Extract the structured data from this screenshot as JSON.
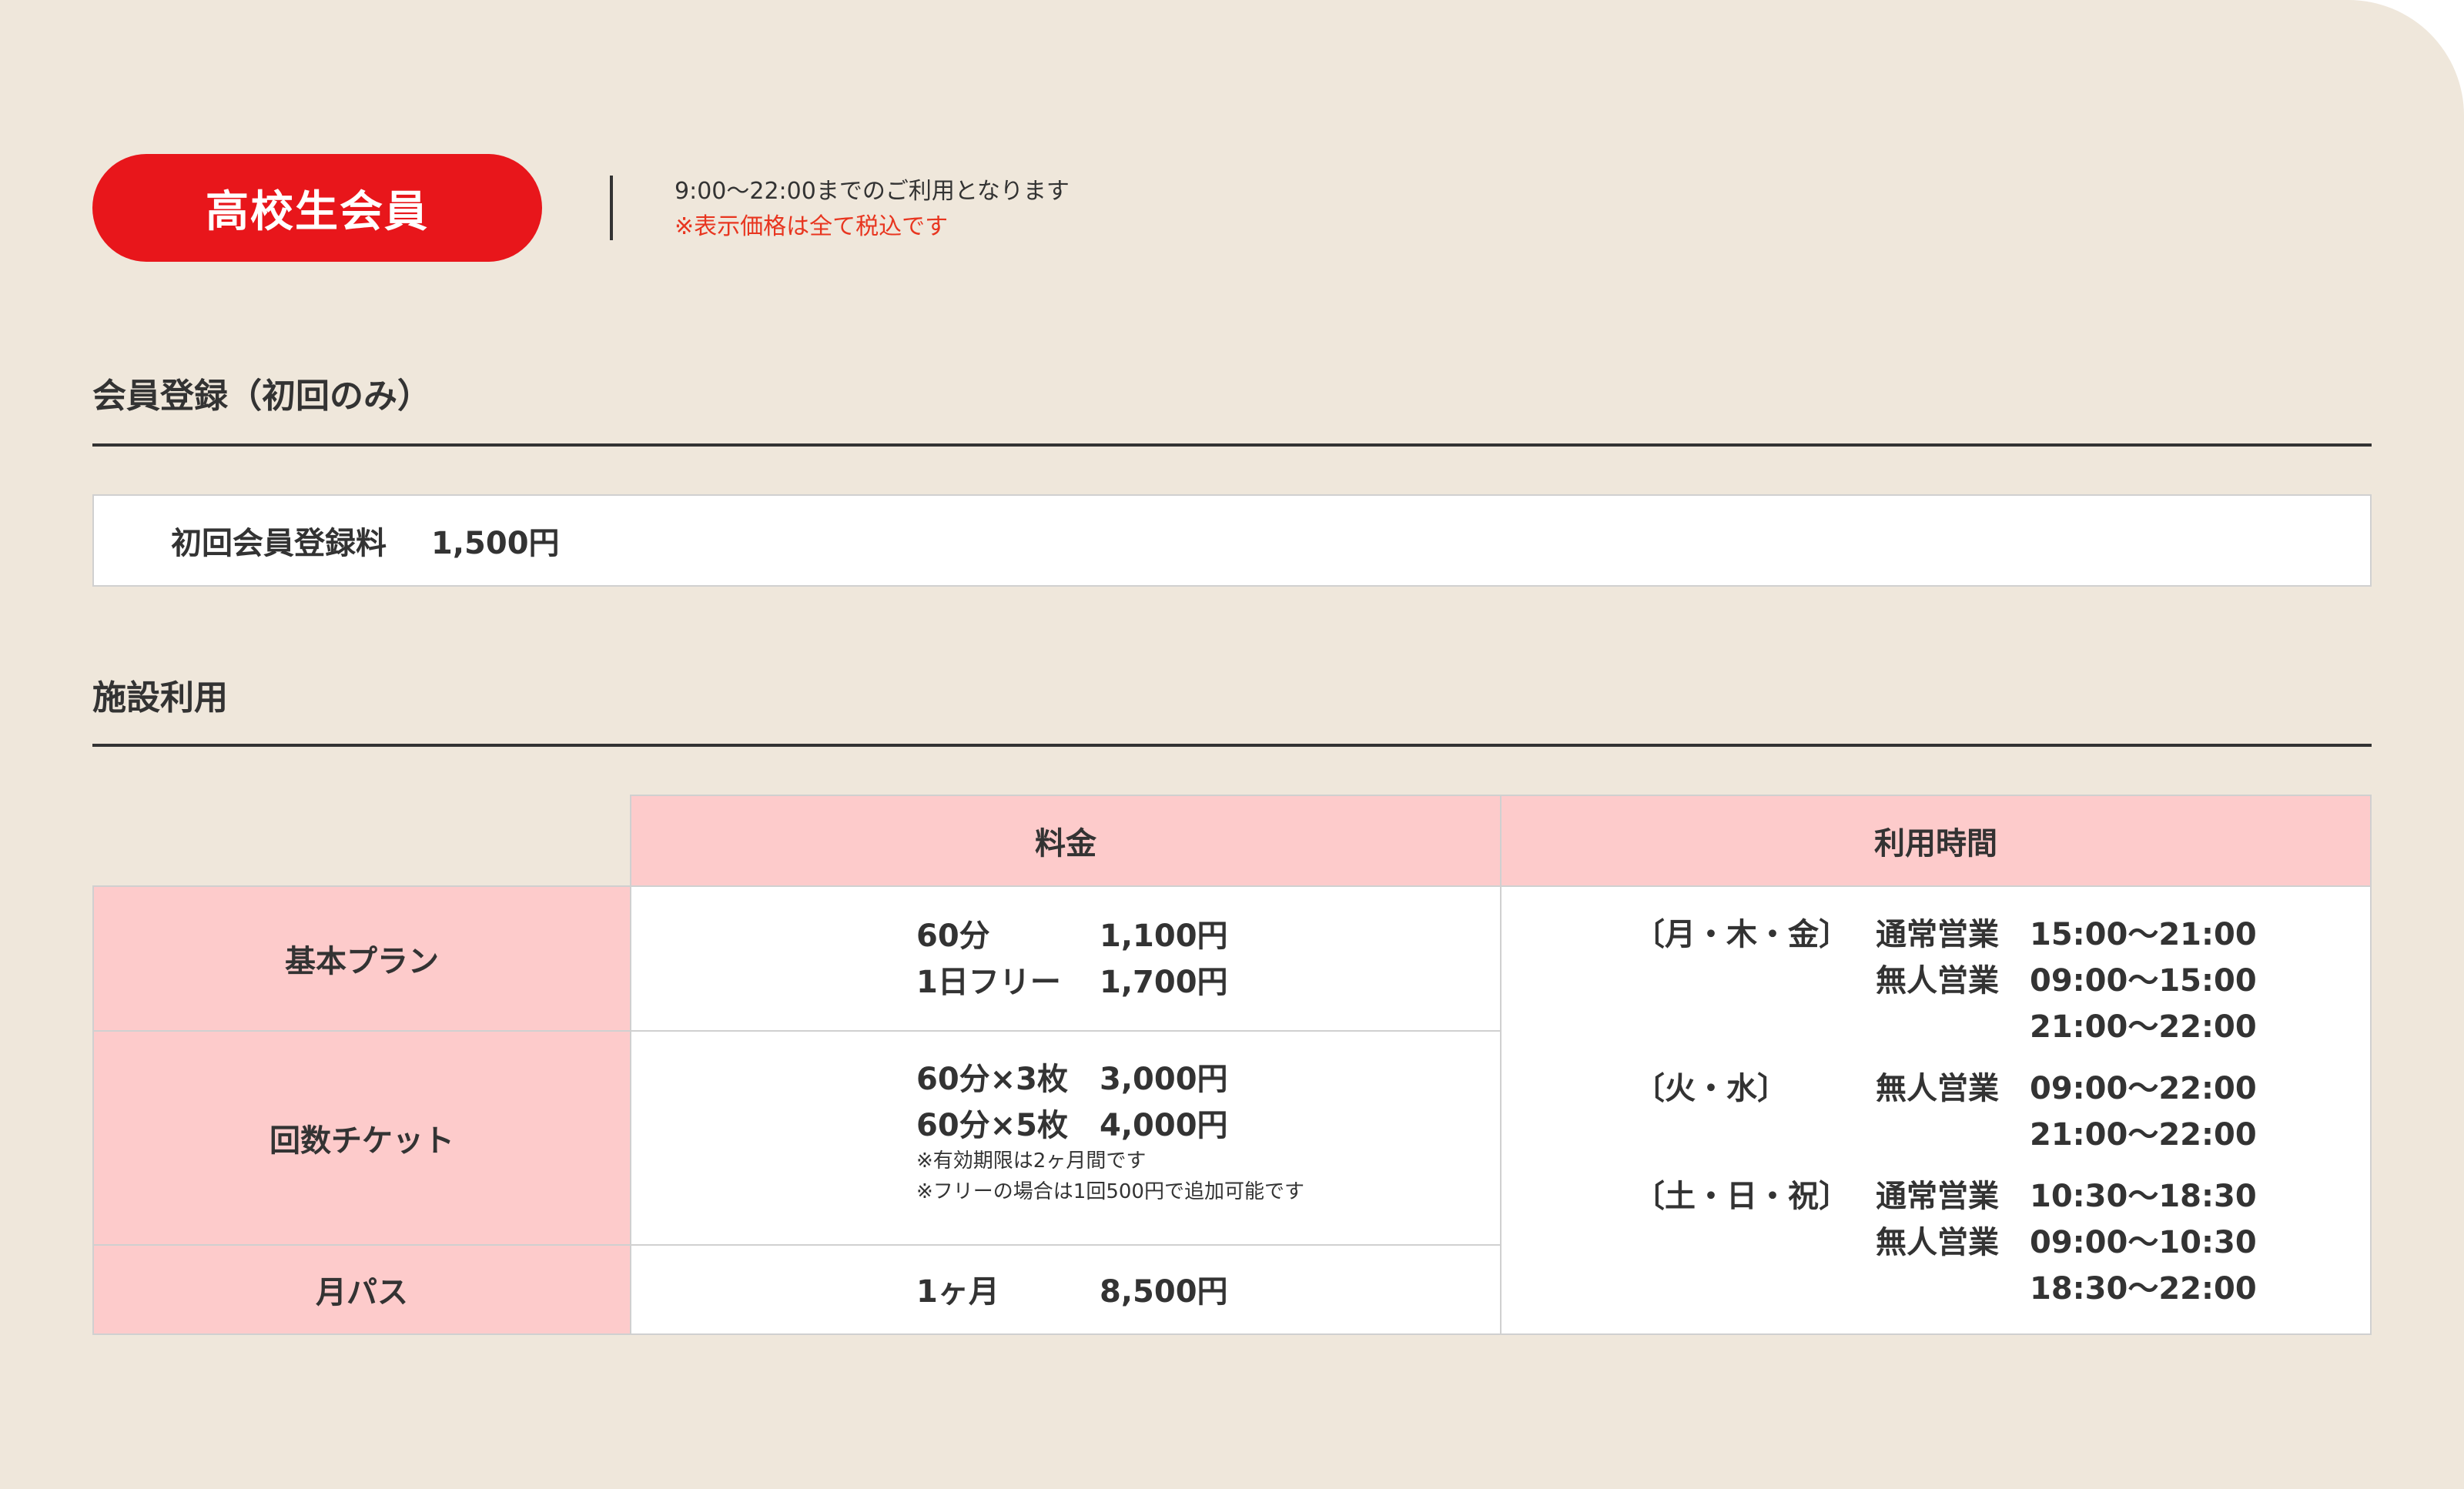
{
  "badge": "高校生会員",
  "notes": {
    "line1": "9:00〜22:00までのご利用となります",
    "line2": "※表示価格は全て税込です"
  },
  "registration": {
    "title": "会員登録（初回のみ）",
    "label": "初回会員登録料",
    "price": "1,500円"
  },
  "facility": {
    "title": "施設利用",
    "headers": {
      "price": "料金",
      "hours": "利用時間"
    },
    "plans": [
      {
        "name": "基本プラン",
        "prices": [
          {
            "label": "60分",
            "price": "1,100円"
          },
          {
            "label": "1日フリー",
            "price": "1,700円"
          }
        ],
        "notes": []
      },
      {
        "name": "回数チケット",
        "prices": [
          {
            "label": "60分×3枚",
            "price": "3,000円"
          },
          {
            "label": "60分×5枚",
            "price": "4,000円"
          }
        ],
        "notes": [
          "※有効期限は2ヶ月間です",
          "※フリーの場合は1回500円で追加可能です"
        ]
      },
      {
        "name": "月パス",
        "prices": [
          {
            "label": "1ヶ月",
            "price": "8,500円"
          }
        ],
        "notes": []
      }
    ],
    "hours": [
      {
        "days": "〔月・木・金〕",
        "rows": [
          {
            "type": "通常営業",
            "time": "15:00〜21:00"
          },
          {
            "type": "無人営業",
            "time": "09:00〜15:00"
          },
          {
            "type": "",
            "time": "21:00〜22:00"
          }
        ]
      },
      {
        "days": "〔火・水〕",
        "rows": [
          {
            "type": "無人営業",
            "time": "09:00〜22:00"
          },
          {
            "type": "",
            "time": "21:00〜22:00"
          }
        ]
      },
      {
        "days": "〔土・日・祝〕",
        "rows": [
          {
            "type": "通常営業",
            "time": "10:30〜18:30"
          },
          {
            "type": "無人営業",
            "time": "09:00〜10:30"
          },
          {
            "type": "",
            "time": "18:30〜22:00"
          }
        ]
      }
    ]
  }
}
